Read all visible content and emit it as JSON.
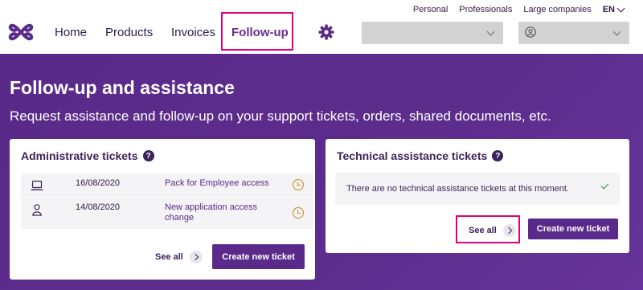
{
  "utility": {
    "links": [
      "Personal",
      "Professionals",
      "Large companies"
    ],
    "language": "EN"
  },
  "nav": {
    "items": [
      {
        "label": "Home",
        "active": false
      },
      {
        "label": "Products",
        "active": false
      },
      {
        "label": "Invoices",
        "active": false
      },
      {
        "label": "Follow-up",
        "active": true
      }
    ],
    "settings_icon": "gear-icon",
    "account_select_value": "",
    "user_select_value": ""
  },
  "hero": {
    "title": "Follow-up and assistance",
    "subtitle": "Request assistance and follow-up on your support tickets, orders, shared documents, etc."
  },
  "admin_card": {
    "title": "Administrative tickets",
    "tickets": [
      {
        "icon": "laptop-icon",
        "date": "16/08/2020",
        "name": "Pack for Employee access",
        "status_icon": "clock-icon"
      },
      {
        "icon": "person-icon",
        "date": "14/08/2020",
        "name": "New application access change",
        "status_icon": "clock-icon"
      }
    ],
    "see_all": "See all",
    "create_button": "Create new ticket"
  },
  "tech_card": {
    "title": "Technical assistance tickets",
    "empty_message": "There are no technical assistance tickets at this moment.",
    "see_all": "See all",
    "create_button": "Create new ticket"
  },
  "colors": {
    "brand_purple": "#5a2a8a",
    "highlight_pink": "#e2007a",
    "pending_amber": "#c48a1c",
    "ok_green": "#2e8b3a"
  }
}
